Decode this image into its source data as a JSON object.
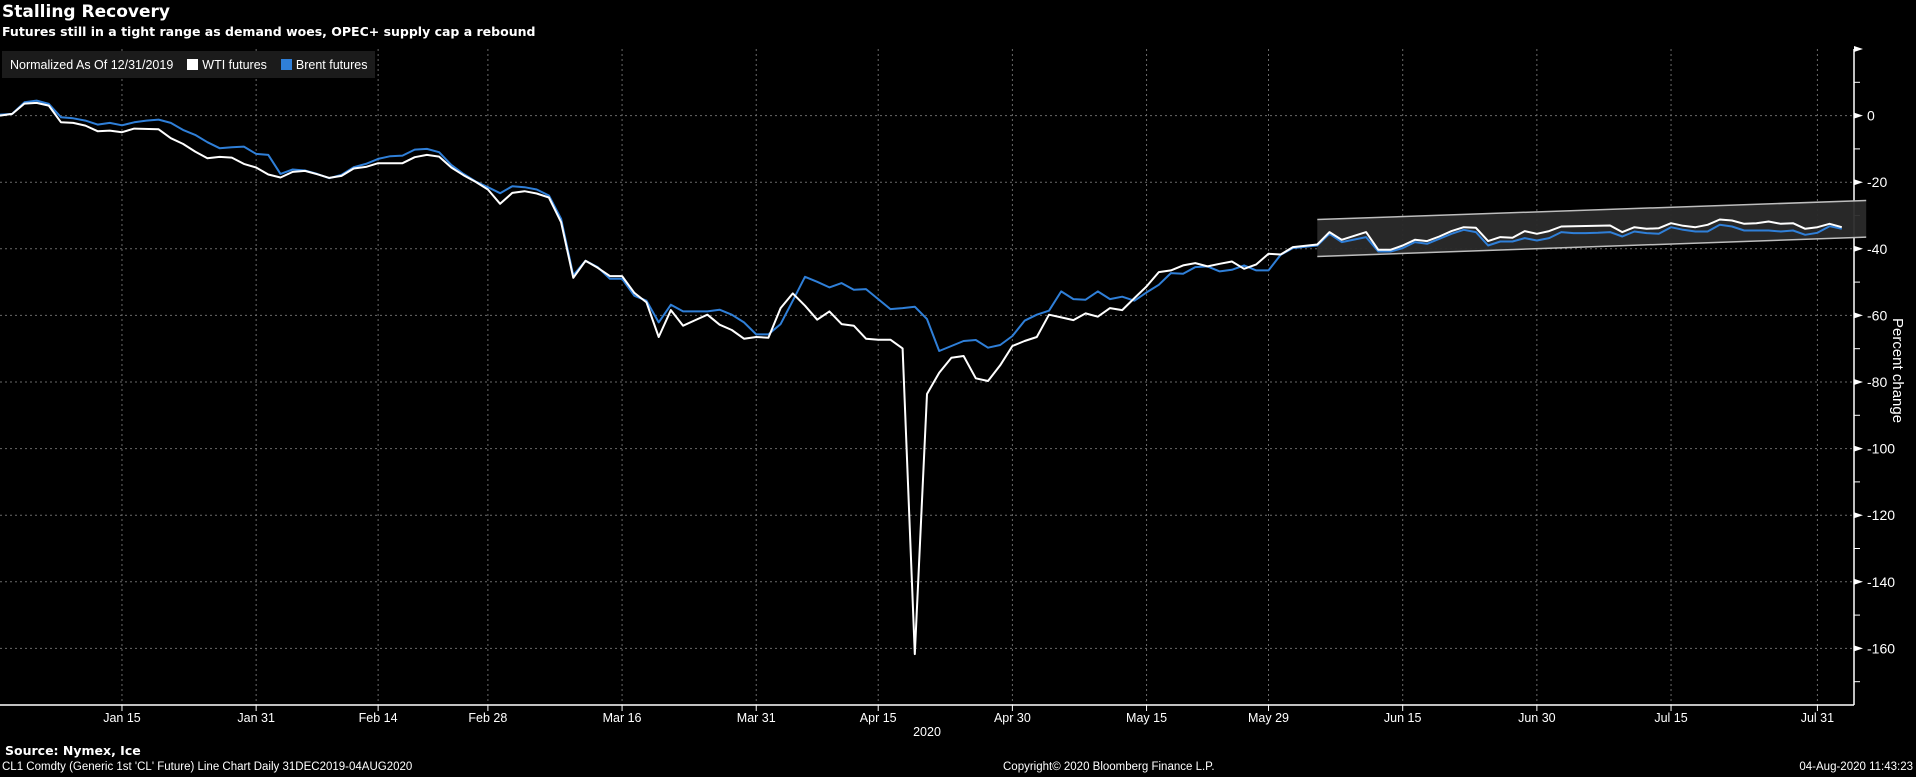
{
  "chart_data": {
    "type": "line",
    "title": "Stalling Recovery",
    "subtitle": "Futures still in a tight range as demand woes, OPEC+ supply cap a rebound",
    "legend_note": "Normalized As Of 12/31/2019",
    "legend_position": "top-left",
    "xlabel": "2020",
    "ylabel": "Percent change",
    "x_unit": "trading days since 31 Dec 2019",
    "xlim": [
      0,
      152
    ],
    "ylim": [
      -177,
      20
    ],
    "grid": true,
    "x_ticks": [
      {
        "label": "Jan 15",
        "x": 10
      },
      {
        "label": "Jan 31",
        "x": 21
      },
      {
        "label": "Feb 14",
        "x": 31
      },
      {
        "label": "Feb 28",
        "x": 40
      },
      {
        "label": "Mar 16",
        "x": 51
      },
      {
        "label": "Mar 31",
        "x": 62
      },
      {
        "label": "Apr 15",
        "x": 72
      },
      {
        "label": "Apr 30",
        "x": 83
      },
      {
        "label": "May 15",
        "x": 94
      },
      {
        "label": "May 29",
        "x": 104
      },
      {
        "label": "Jun 15",
        "x": 115
      },
      {
        "label": "Jun 30",
        "x": 126
      },
      {
        "label": "Jul 15",
        "x": 137
      },
      {
        "label": "Jul 31",
        "x": 149
      }
    ],
    "y_ticks": [
      0,
      -20,
      -40,
      -60,
      -80,
      -100,
      -120,
      -140,
      -160
    ],
    "series": [
      {
        "name": "WTI futures",
        "color": "#ffffff",
        "points": [
          [
            0,
            0
          ],
          [
            1,
            0.5
          ],
          [
            2,
            3.6
          ],
          [
            3,
            3.8
          ],
          [
            4,
            3
          ],
          [
            5,
            -2
          ],
          [
            6,
            -2.2
          ],
          [
            7,
            -3
          ],
          [
            8,
            -4.7
          ],
          [
            9,
            -4.5
          ],
          [
            10,
            -5
          ],
          [
            11,
            -3.9
          ],
          [
            13,
            -4.1
          ],
          [
            14,
            -6.8
          ],
          [
            15,
            -8.5
          ],
          [
            16,
            -10.8
          ],
          [
            17,
            -12.8
          ],
          [
            18,
            -12.4
          ],
          [
            19,
            -12.6
          ],
          [
            20,
            -14.5
          ],
          [
            21,
            -15.6
          ],
          [
            22,
            -17.7
          ],
          [
            23,
            -18.6
          ],
          [
            24,
            -16.9
          ],
          [
            25,
            -16.6
          ],
          [
            26,
            -17.6
          ],
          [
            27,
            -18.7
          ],
          [
            28,
            -18.1
          ],
          [
            29,
            -15.9
          ],
          [
            30,
            -15.4
          ],
          [
            31,
            -14.3
          ],
          [
            33,
            -14.3
          ],
          [
            34,
            -12.5
          ],
          [
            35,
            -11.8
          ],
          [
            36,
            -12.3
          ],
          [
            37,
            -15.6
          ],
          [
            38,
            -17.9
          ],
          [
            39,
            -19.9
          ],
          [
            40,
            -22.2
          ],
          [
            41,
            -26.5
          ],
          [
            42,
            -23.2
          ],
          [
            43,
            -22.7
          ],
          [
            44,
            -23.4
          ],
          [
            45,
            -24.6
          ],
          [
            46,
            -32
          ],
          [
            47,
            -48.7
          ],
          [
            48,
            -43.6
          ],
          [
            49,
            -45.7
          ],
          [
            50,
            -48.2
          ],
          [
            51,
            -48.2
          ],
          [
            52,
            -53.2
          ],
          [
            53,
            -56.1
          ],
          [
            54,
            -66.5
          ],
          [
            55,
            -58.4
          ],
          [
            56,
            -63.1
          ],
          [
            57,
            -61.4
          ],
          [
            58,
            -59.8
          ],
          [
            59,
            -62.8
          ],
          [
            60,
            -64.4
          ],
          [
            61,
            -67
          ],
          [
            62,
            -66.5
          ],
          [
            63,
            -66.7
          ],
          [
            64,
            -57.8
          ],
          [
            65,
            -53.4
          ],
          [
            66,
            -57.1
          ],
          [
            67,
            -61.3
          ],
          [
            68,
            -58.8
          ],
          [
            69,
            -62.6
          ],
          [
            70,
            -63.1
          ],
          [
            71,
            -67
          ],
          [
            72,
            -67.3
          ],
          [
            73,
            -67.3
          ],
          [
            74,
            -69.9
          ],
          [
            75,
            -161.7
          ],
          [
            76,
            -83.6
          ],
          [
            77,
            -77.2
          ],
          [
            78,
            -72.7
          ],
          [
            79,
            -72.2
          ],
          [
            80,
            -78.9
          ],
          [
            81,
            -79.7
          ],
          [
            82,
            -75
          ],
          [
            83,
            -69.2
          ],
          [
            84,
            -67.7
          ],
          [
            85,
            -66.5
          ],
          [
            86,
            -59.8
          ],
          [
            87,
            -60.6
          ],
          [
            88,
            -61.4
          ],
          [
            89,
            -59.4
          ],
          [
            90,
            -60.4
          ],
          [
            91,
            -57.8
          ],
          [
            92,
            -58.4
          ],
          [
            93,
            -54.8
          ],
          [
            94,
            -51.3
          ],
          [
            95,
            -47
          ],
          [
            96,
            -46.5
          ],
          [
            97,
            -45
          ],
          [
            98,
            -44.3
          ],
          [
            99,
            -45.3
          ],
          [
            100,
            -44.5
          ],
          [
            101,
            -43.8
          ],
          [
            102,
            -46
          ],
          [
            103,
            -44.7
          ],
          [
            104,
            -41.5
          ],
          [
            105,
            -41.7
          ],
          [
            106,
            -39.5
          ],
          [
            108,
            -38.7
          ],
          [
            109,
            -35
          ],
          [
            110,
            -37.3
          ],
          [
            112,
            -35
          ],
          [
            113,
            -40.3
          ],
          [
            114,
            -40.3
          ],
          [
            115,
            -39
          ],
          [
            116,
            -37.3
          ],
          [
            117,
            -37.7
          ],
          [
            118,
            -36.3
          ],
          [
            119,
            -34.7
          ],
          [
            120,
            -33.5
          ],
          [
            121,
            -33.7
          ],
          [
            122,
            -37.7
          ],
          [
            123,
            -36.5
          ],
          [
            124,
            -36.7
          ],
          [
            125,
            -34.7
          ],
          [
            126,
            -35.5
          ],
          [
            127,
            -34.7
          ],
          [
            128,
            -33.3
          ],
          [
            132,
            -33
          ],
          [
            133,
            -35
          ],
          [
            134,
            -33.5
          ],
          [
            135,
            -34
          ],
          [
            136,
            -33.8
          ],
          [
            137,
            -32.3
          ],
          [
            138,
            -33.1
          ],
          [
            139,
            -33.5
          ],
          [
            140,
            -32.8
          ],
          [
            141,
            -31.2
          ],
          [
            142,
            -31.5
          ],
          [
            143,
            -32.5
          ],
          [
            144,
            -32.3
          ],
          [
            145,
            -31.8
          ],
          [
            146,
            -32.5
          ],
          [
            147,
            -32.3
          ],
          [
            148,
            -34
          ],
          [
            149,
            -33.5
          ],
          [
            150,
            -32.5
          ],
          [
            151,
            -33.5
          ]
        ]
      },
      {
        "name": "Brent futures",
        "color": "#2f7fd8",
        "points": [
          [
            0,
            0.3
          ],
          [
            1,
            0.5
          ],
          [
            2,
            4
          ],
          [
            3,
            4.5
          ],
          [
            4,
            3.5
          ],
          [
            5,
            -0.5
          ],
          [
            6,
            -0.8
          ],
          [
            7,
            -1.5
          ],
          [
            8,
            -2.7
          ],
          [
            9,
            -2.2
          ],
          [
            10,
            -2.9
          ],
          [
            11,
            -2
          ],
          [
            12,
            -1.5
          ],
          [
            13,
            -1.2
          ],
          [
            14,
            -2.2
          ],
          [
            15,
            -4.3
          ],
          [
            16,
            -5.8
          ],
          [
            17,
            -8
          ],
          [
            18,
            -9.8
          ],
          [
            19,
            -9.5
          ],
          [
            20,
            -9.3
          ],
          [
            21,
            -11.5
          ],
          [
            22,
            -11.8
          ],
          [
            23,
            -17.5
          ],
          [
            24,
            -16.2
          ],
          [
            25,
            -16.5
          ],
          [
            26,
            -17.5
          ],
          [
            27,
            -18.8
          ],
          [
            28,
            -17.8
          ],
          [
            29,
            -15.5
          ],
          [
            30,
            -14.5
          ],
          [
            31,
            -13
          ],
          [
            32,
            -12.2
          ],
          [
            33,
            -12
          ],
          [
            34,
            -10.2
          ],
          [
            35,
            -10
          ],
          [
            36,
            -11
          ],
          [
            37,
            -14.8
          ],
          [
            38,
            -17.5
          ],
          [
            39,
            -19.8
          ],
          [
            40,
            -21.5
          ],
          [
            41,
            -23.3
          ],
          [
            42,
            -21.2
          ],
          [
            43,
            -21.5
          ],
          [
            44,
            -22.2
          ],
          [
            45,
            -24
          ],
          [
            46,
            -31
          ],
          [
            47,
            -48
          ],
          [
            48,
            -43.6
          ],
          [
            49,
            -45.5
          ],
          [
            50,
            -49
          ],
          [
            51,
            -49
          ],
          [
            52,
            -54.1
          ],
          [
            53,
            -55.6
          ],
          [
            54,
            -62.1
          ],
          [
            55,
            -56.8
          ],
          [
            56,
            -58.8
          ],
          [
            58,
            -58.8
          ],
          [
            59,
            -58.3
          ],
          [
            60,
            -59.8
          ],
          [
            61,
            -62.1
          ],
          [
            62,
            -65.7
          ],
          [
            63,
            -65.7
          ],
          [
            64,
            -62.6
          ],
          [
            65,
            -55.6
          ],
          [
            66,
            -48.4
          ],
          [
            67,
            -49.9
          ],
          [
            68,
            -51.6
          ],
          [
            69,
            -50.3
          ],
          [
            70,
            -52.3
          ],
          [
            71,
            -52.1
          ],
          [
            72,
            -55.1
          ],
          [
            73,
            -58.1
          ],
          [
            74,
            -57.8
          ],
          [
            75,
            -57.4
          ],
          [
            76,
            -61.1
          ],
          [
            77,
            -70.7
          ],
          [
            78,
            -69.2
          ],
          [
            79,
            -67.7
          ],
          [
            80,
            -67.4
          ],
          [
            81,
            -69.7
          ],
          [
            82,
            -68.9
          ],
          [
            83,
            -66.2
          ],
          [
            84,
            -61.6
          ],
          [
            85,
            -59.8
          ],
          [
            86,
            -58.6
          ],
          [
            87,
            -52.8
          ],
          [
            88,
            -55.1
          ],
          [
            89,
            -55.3
          ],
          [
            90,
            -52.8
          ],
          [
            91,
            -55.1
          ],
          [
            92,
            -54.4
          ],
          [
            93,
            -55.6
          ],
          [
            94,
            -53.1
          ],
          [
            95,
            -50.8
          ],
          [
            96,
            -47.3
          ],
          [
            97,
            -47.5
          ],
          [
            98,
            -45.5
          ],
          [
            99,
            -45.3
          ],
          [
            100,
            -46.8
          ],
          [
            101,
            -46.3
          ],
          [
            102,
            -45
          ],
          [
            103,
            -46.5
          ],
          [
            104,
            -46.5
          ],
          [
            105,
            -41.8
          ],
          [
            106,
            -39.8
          ],
          [
            108,
            -39
          ],
          [
            109,
            -35.5
          ],
          [
            110,
            -38
          ],
          [
            112,
            -36.5
          ],
          [
            113,
            -40.8
          ],
          [
            114,
            -40.8
          ],
          [
            115,
            -39.8
          ],
          [
            116,
            -38
          ],
          [
            117,
            -38.5
          ],
          [
            118,
            -37
          ],
          [
            119,
            -35.5
          ],
          [
            120,
            -34.3
          ],
          [
            121,
            -35
          ],
          [
            122,
            -39
          ],
          [
            123,
            -37.8
          ],
          [
            124,
            -37.8
          ],
          [
            125,
            -36.8
          ],
          [
            126,
            -37.5
          ],
          [
            127,
            -36.8
          ],
          [
            128,
            -35
          ],
          [
            129,
            -35.3
          ],
          [
            130,
            -35.3
          ],
          [
            131,
            -35.2
          ],
          [
            132,
            -35
          ],
          [
            133,
            -36.3
          ],
          [
            134,
            -34.8
          ],
          [
            135,
            -35.3
          ],
          [
            136,
            -35.5
          ],
          [
            137,
            -33.5
          ],
          [
            138,
            -34.3
          ],
          [
            139,
            -34.8
          ],
          [
            140,
            -34.8
          ],
          [
            141,
            -32.8
          ],
          [
            142,
            -33.3
          ],
          [
            143,
            -34.5
          ],
          [
            144,
            -34.5
          ],
          [
            145,
            -34.5
          ],
          [
            146,
            -34.8
          ],
          [
            147,
            -34.5
          ],
          [
            148,
            -35.8
          ],
          [
            149,
            -35.2
          ],
          [
            150,
            -33.2
          ],
          [
            151,
            -34
          ]
        ]
      }
    ],
    "annotations": [
      {
        "type": "channel",
        "x": [
          108,
          153
        ],
        "upper": [
          -31.2,
          -25.5
        ],
        "lower": [
          -42.3,
          -36.5
        ],
        "fill": "#2a2a2a",
        "stroke": "#bdbdbd"
      }
    ]
  },
  "footer": {
    "source": "Source: Nymex, Ice",
    "description": "CL1 Comdty (Generic 1st 'CL' Future) Line Chart  Daily 31DEC2019-04AUG2020",
    "copyright": "Copyright© 2020 Bloomberg Finance L.P.",
    "timestamp": "04-Aug-2020 11:43:23"
  }
}
